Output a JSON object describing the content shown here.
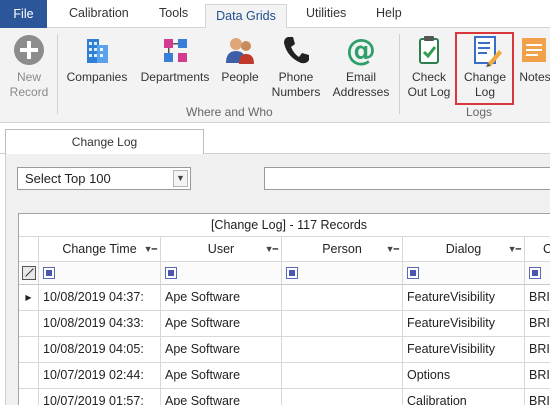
{
  "menu": {
    "file": "File",
    "tabs": [
      "Calibration",
      "Tools",
      "Data Grids",
      "Utilities",
      "Help"
    ],
    "active_tab": "Data Grids"
  },
  "ribbon": {
    "new_record": {
      "line1": "New",
      "line2": "Record"
    },
    "companies": "Companies",
    "departments": "Departments",
    "people": "People",
    "phone": {
      "line1": "Phone",
      "line2": "Numbers"
    },
    "email": {
      "line1": "Email",
      "line2": "Addresses"
    },
    "check_out": {
      "line1": "Check",
      "line2": "Out Log"
    },
    "change_log": {
      "line1": "Change",
      "line2": "Log"
    },
    "notes": "Notes",
    "group_where_who": "Where and Who",
    "group_logs": "Logs"
  },
  "document": {
    "tab_title": "Change Log",
    "select_value": "Select Top 100",
    "grid_caption": "[Change Log] - 117 Records",
    "columns": [
      "Change Time",
      "User",
      "Person",
      "Dialog",
      "C"
    ],
    "rows": [
      {
        "time": "10/08/2019 04:37:",
        "user": "Ape Software",
        "person": "",
        "dialog": "FeatureVisibility",
        "c": "BRI"
      },
      {
        "time": "10/08/2019 04:33:",
        "user": "Ape Software",
        "person": "",
        "dialog": "FeatureVisibility",
        "c": "BRI"
      },
      {
        "time": "10/08/2019 04:05:",
        "user": "Ape Software",
        "person": "",
        "dialog": "FeatureVisibility",
        "c": "BRI"
      },
      {
        "time": "10/07/2019 02:44:",
        "user": "Ape Software",
        "person": "",
        "dialog": "Options",
        "c": "BRI"
      },
      {
        "time": "10/07/2019 01:57:",
        "user": "Ape Software",
        "person": "",
        "dialog": "Calibration",
        "c": "BRI"
      }
    ]
  },
  "colors": {
    "file_tab": "#2b579a",
    "active_tab_text": "#1e4e8c",
    "highlight": "#d9373c",
    "filter_box": "#4a56b0"
  }
}
